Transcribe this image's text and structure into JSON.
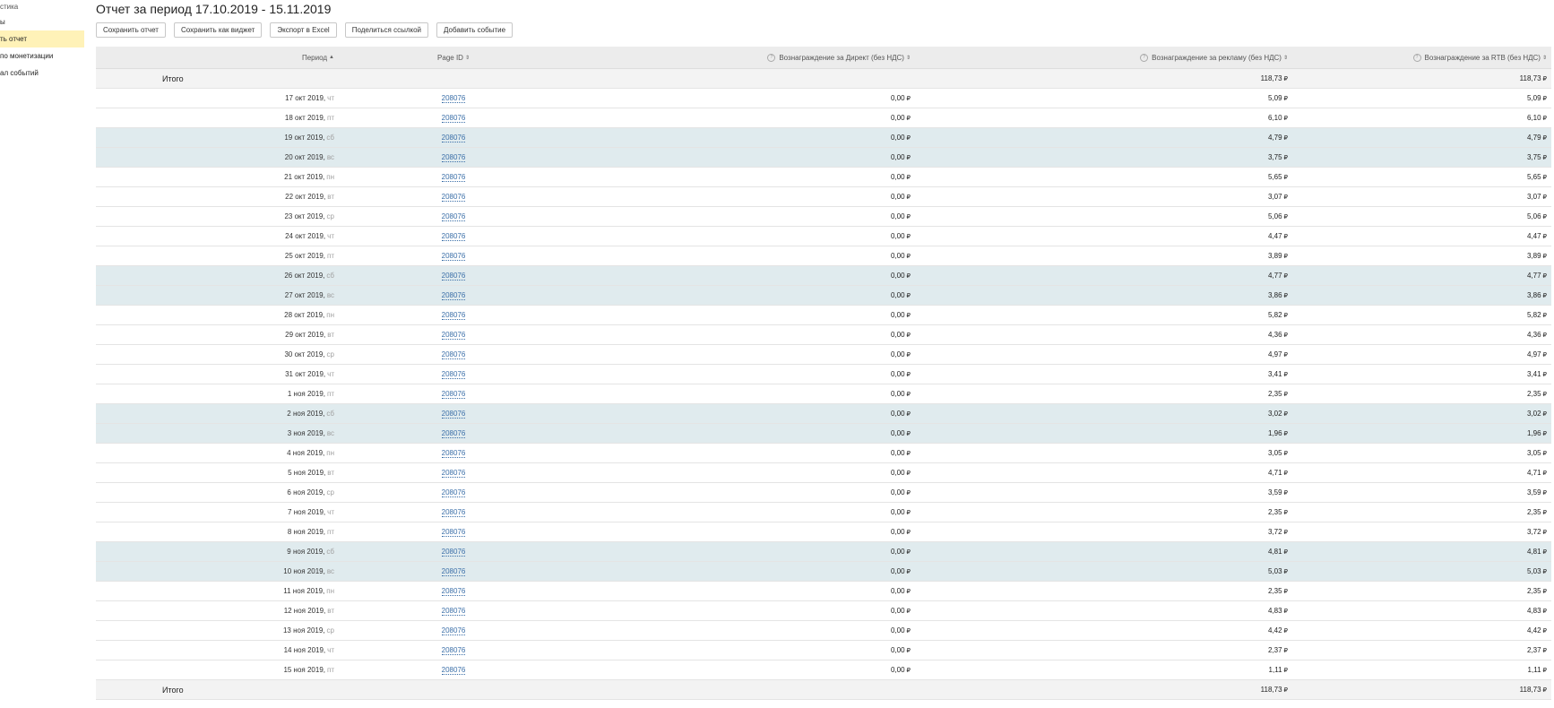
{
  "sidebar": {
    "items": [
      {
        "label": "стика",
        "active": false,
        "head": true
      },
      {
        "label": "ы",
        "active": false,
        "head": false
      },
      {
        "label": "ть отчет",
        "active": true,
        "head": false
      },
      {
        "label": " по монетизации",
        "active": false,
        "head": false
      },
      {
        "label": "ал событий",
        "active": false,
        "head": false
      }
    ]
  },
  "page": {
    "title": "Отчет за период 17.10.2019 - 15.11.2019"
  },
  "toolbar": {
    "buttons": [
      {
        "name": "save-report-button",
        "label": "Сохранить отчет"
      },
      {
        "name": "save-as-widget-button",
        "label": "Сохранить как виджет"
      },
      {
        "name": "export-excel-button",
        "label": "Экспорт в Excel"
      },
      {
        "name": "share-link-button",
        "label": "Поделиться ссылкой"
      },
      {
        "name": "add-event-button",
        "label": "Добавить событие"
      }
    ]
  },
  "table": {
    "headers": {
      "period": "Период",
      "page_id": "Page ID",
      "direct": "Вознаграждение за Директ (без НДС)",
      "ads": "Вознаграждение за рекламу (без НДС)",
      "rtb": "Вознаграждение за RTB (без НДС)"
    },
    "sort_asc": "▲",
    "sort_both": "⇕",
    "info_glyph": "?",
    "currency": "₽",
    "total_label": "Итого",
    "totals": {
      "ads": "118,73",
      "rtb": "118,73"
    },
    "rows": [
      {
        "date": "17 окт 2019,",
        "wd": "чт",
        "page": "208076",
        "direct": "0,00",
        "ads": "5,09",
        "rtb": "5,09",
        "weekend": false
      },
      {
        "date": "18 окт 2019,",
        "wd": "пт",
        "page": "208076",
        "direct": "0,00",
        "ads": "6,10",
        "rtb": "6,10",
        "weekend": false
      },
      {
        "date": "19 окт 2019,",
        "wd": "сб",
        "page": "208076",
        "direct": "0,00",
        "ads": "4,79",
        "rtb": "4,79",
        "weekend": true
      },
      {
        "date": "20 окт 2019,",
        "wd": "вс",
        "page": "208076",
        "direct": "0,00",
        "ads": "3,75",
        "rtb": "3,75",
        "weekend": true
      },
      {
        "date": "21 окт 2019,",
        "wd": "пн",
        "page": "208076",
        "direct": "0,00",
        "ads": "5,65",
        "rtb": "5,65",
        "weekend": false
      },
      {
        "date": "22 окт 2019,",
        "wd": "вт",
        "page": "208076",
        "direct": "0,00",
        "ads": "3,07",
        "rtb": "3,07",
        "weekend": false
      },
      {
        "date": "23 окт 2019,",
        "wd": "ср",
        "page": "208076",
        "direct": "0,00",
        "ads": "5,06",
        "rtb": "5,06",
        "weekend": false
      },
      {
        "date": "24 окт 2019,",
        "wd": "чт",
        "page": "208076",
        "direct": "0,00",
        "ads": "4,47",
        "rtb": "4,47",
        "weekend": false
      },
      {
        "date": "25 окт 2019,",
        "wd": "пт",
        "page": "208076",
        "direct": "0,00",
        "ads": "3,89",
        "rtb": "3,89",
        "weekend": false
      },
      {
        "date": "26 окт 2019,",
        "wd": "сб",
        "page": "208076",
        "direct": "0,00",
        "ads": "4,77",
        "rtb": "4,77",
        "weekend": true
      },
      {
        "date": "27 окт 2019,",
        "wd": "вс",
        "page": "208076",
        "direct": "0,00",
        "ads": "3,86",
        "rtb": "3,86",
        "weekend": true
      },
      {
        "date": "28 окт 2019,",
        "wd": "пн",
        "page": "208076",
        "direct": "0,00",
        "ads": "5,82",
        "rtb": "5,82",
        "weekend": false
      },
      {
        "date": "29 окт 2019,",
        "wd": "вт",
        "page": "208076",
        "direct": "0,00",
        "ads": "4,36",
        "rtb": "4,36",
        "weekend": false
      },
      {
        "date": "30 окт 2019,",
        "wd": "ср",
        "page": "208076",
        "direct": "0,00",
        "ads": "4,97",
        "rtb": "4,97",
        "weekend": false
      },
      {
        "date": "31 окт 2019,",
        "wd": "чт",
        "page": "208076",
        "direct": "0,00",
        "ads": "3,41",
        "rtb": "3,41",
        "weekend": false
      },
      {
        "date": "1 ноя 2019,",
        "wd": "пт",
        "page": "208076",
        "direct": "0,00",
        "ads": "2,35",
        "rtb": "2,35",
        "weekend": false
      },
      {
        "date": "2 ноя 2019,",
        "wd": "сб",
        "page": "208076",
        "direct": "0,00",
        "ads": "3,02",
        "rtb": "3,02",
        "weekend": true
      },
      {
        "date": "3 ноя 2019,",
        "wd": "вс",
        "page": "208076",
        "direct": "0,00",
        "ads": "1,96",
        "rtb": "1,96",
        "weekend": true
      },
      {
        "date": "4 ноя 2019,",
        "wd": "пн",
        "page": "208076",
        "direct": "0,00",
        "ads": "3,05",
        "rtb": "3,05",
        "weekend": false
      },
      {
        "date": "5 ноя 2019,",
        "wd": "вт",
        "page": "208076",
        "direct": "0,00",
        "ads": "4,71",
        "rtb": "4,71",
        "weekend": false
      },
      {
        "date": "6 ноя 2019,",
        "wd": "ср",
        "page": "208076",
        "direct": "0,00",
        "ads": "3,59",
        "rtb": "3,59",
        "weekend": false
      },
      {
        "date": "7 ноя 2019,",
        "wd": "чт",
        "page": "208076",
        "direct": "0,00",
        "ads": "2,35",
        "rtb": "2,35",
        "weekend": false
      },
      {
        "date": "8 ноя 2019,",
        "wd": "пт",
        "page": "208076",
        "direct": "0,00",
        "ads": "3,72",
        "rtb": "3,72",
        "weekend": false
      },
      {
        "date": "9 ноя 2019,",
        "wd": "сб",
        "page": "208076",
        "direct": "0,00",
        "ads": "4,81",
        "rtb": "4,81",
        "weekend": true
      },
      {
        "date": "10 ноя 2019,",
        "wd": "вс",
        "page": "208076",
        "direct": "0,00",
        "ads": "5,03",
        "rtb": "5,03",
        "weekend": true
      },
      {
        "date": "11 ноя 2019,",
        "wd": "пн",
        "page": "208076",
        "direct": "0,00",
        "ads": "2,35",
        "rtb": "2,35",
        "weekend": false
      },
      {
        "date": "12 ноя 2019,",
        "wd": "вт",
        "page": "208076",
        "direct": "0,00",
        "ads": "4,83",
        "rtb": "4,83",
        "weekend": false
      },
      {
        "date": "13 ноя 2019,",
        "wd": "ср",
        "page": "208076",
        "direct": "0,00",
        "ads": "4,42",
        "rtb": "4,42",
        "weekend": false
      },
      {
        "date": "14 ноя 2019,",
        "wd": "чт",
        "page": "208076",
        "direct": "0,00",
        "ads": "2,37",
        "rtb": "2,37",
        "weekend": false
      },
      {
        "date": "15 ноя 2019,",
        "wd": "пт",
        "page": "208076",
        "direct": "0,00",
        "ads": "1,11",
        "rtb": "1,11",
        "weekend": false
      }
    ]
  }
}
